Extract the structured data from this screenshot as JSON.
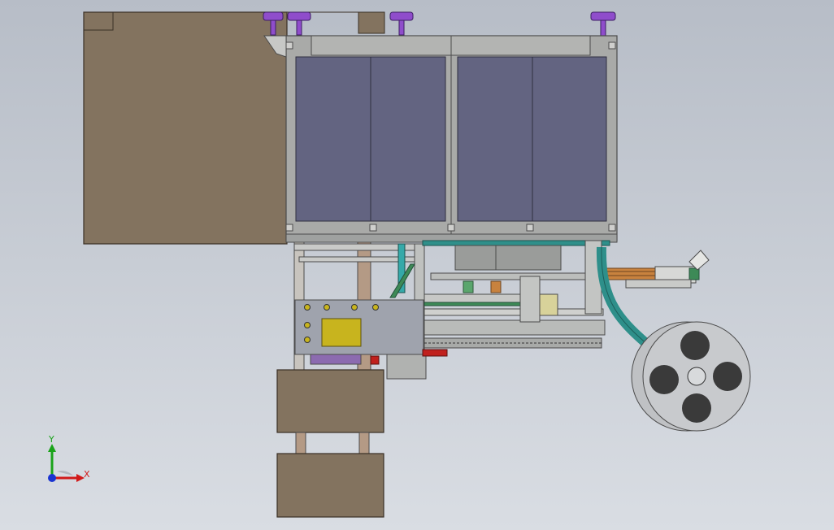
{
  "viewport": {
    "background_top": "#b7bdc7",
    "background_bottom": "#d9dde3"
  },
  "colors": {
    "panel_brown": "#83735f",
    "panel_edge": "#3a3026",
    "glass": "#636481",
    "frame": "#a9aaa8",
    "frame_dark": "#4b4b4b",
    "purple": "#8f4dcb",
    "control_panel": "#9fa3ad",
    "screen_yellow": "#c8b41e",
    "teal_hose": "#2e8f8a",
    "rod": "#b49a85",
    "reel": "#c8cacd",
    "reel_hole": "#3a3a3a",
    "green": "#3d8a57",
    "red": "#c0201d",
    "orange": "#c8823e"
  },
  "axes": {
    "x_label": "X",
    "y_label": "Y",
    "x_color": "#d11a1a",
    "y_color": "#1aa31a",
    "z_color": "#1a34d1",
    "icon": "coordinate-triad-icon"
  }
}
